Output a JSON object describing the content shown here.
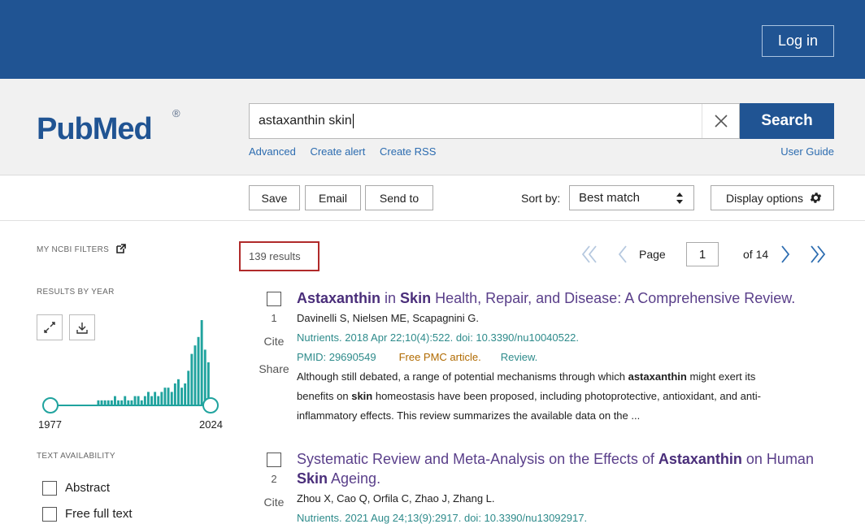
{
  "header": {
    "login_label": "Log in"
  },
  "logo": {
    "text": "PubMed",
    "reg": "®"
  },
  "search": {
    "query": "astaxanthin skin",
    "button_label": "Search",
    "links": [
      "Advanced",
      "Create alert",
      "Create RSS"
    ],
    "user_guide": "User Guide"
  },
  "toolbar": {
    "save": "Save",
    "email": "Email",
    "send_to": "Send to",
    "sort_label": "Sort by:",
    "sort_value": "Best match",
    "display_options": "Display options"
  },
  "sidebar": {
    "my_ncbi_filters": "MY NCBI FILTERS",
    "results_by_year": "RESULTS BY YEAR",
    "year_start": "1977",
    "year_end": "2024",
    "text_availability": "TEXT AVAILABILITY",
    "filters": [
      "Abstract",
      "Free full text"
    ]
  },
  "results": {
    "count_label": "139 results",
    "page_label": "Page",
    "page_value": "1",
    "of_label": "of 14"
  },
  "chart_data": {
    "type": "bar",
    "title": "RESULTS BY YEAR",
    "x_range": [
      1977,
      2024
    ],
    "values": [
      1,
      0,
      0,
      0,
      0,
      0,
      0,
      0,
      0,
      0,
      0,
      0,
      0,
      0,
      1,
      1,
      1,
      1,
      1,
      2,
      1,
      1,
      2,
      1,
      1,
      2,
      2,
      1,
      2,
      3,
      2,
      3,
      2,
      3,
      4,
      4,
      3,
      5,
      6,
      4,
      5,
      8,
      12,
      14,
      16,
      20,
      13,
      10
    ]
  },
  "articles": [
    {
      "num": "1",
      "title_parts": [
        {
          "t": "Astaxanthin",
          "b": true
        },
        {
          "t": " in ",
          "b": false
        },
        {
          "t": "Skin",
          "b": true
        },
        {
          "t": " Health, Repair, and Disease: A Comprehensive Review.",
          "b": false
        }
      ],
      "authors": "Davinelli S, Nielsen ME, Scapagnini G.",
      "journal": "Nutrients. 2018 Apr 22;10(4):522. doi: 10.3390/nu10040522.",
      "pmid": "PMID: 29690549",
      "free": "Free PMC article.",
      "type": "Review.",
      "snippet_lines": [
        [
          {
            "t": "Although still debated, a range of potential mechanisms through which ",
            "b": false
          },
          {
            "t": "astaxanthin",
            "b": true
          },
          {
            "t": " might exert its",
            "b": false
          }
        ],
        [
          {
            "t": "benefits on ",
            "b": false
          },
          {
            "t": "skin",
            "b": true
          },
          {
            "t": " homeostasis have been proposed, including photoprotective, antioxidant, and anti-",
            "b": false
          }
        ],
        [
          {
            "t": "inflammatory effects. This review summarizes the available data on the ...",
            "b": false
          }
        ]
      ],
      "cite": "Cite",
      "share": "Share"
    },
    {
      "num": "2",
      "title_line1": [
        {
          "t": "Systematic Review and Meta-Analysis on the Effects of ",
          "b": false
        },
        {
          "t": "Astaxanthin",
          "b": true
        },
        {
          "t": " on Human",
          "b": false
        }
      ],
      "title_line2": [
        {
          "t": "Skin",
          "b": true
        },
        {
          "t": " Ageing.",
          "b": false
        }
      ],
      "authors": "Zhou X, Cao Q, Orfila C, Zhao J, Zhang L.",
      "journal": "Nutrients. 2021 Aug 24;13(9):2917. doi: 10.3390/nu13092917.",
      "cite": "Cite"
    }
  ]
}
